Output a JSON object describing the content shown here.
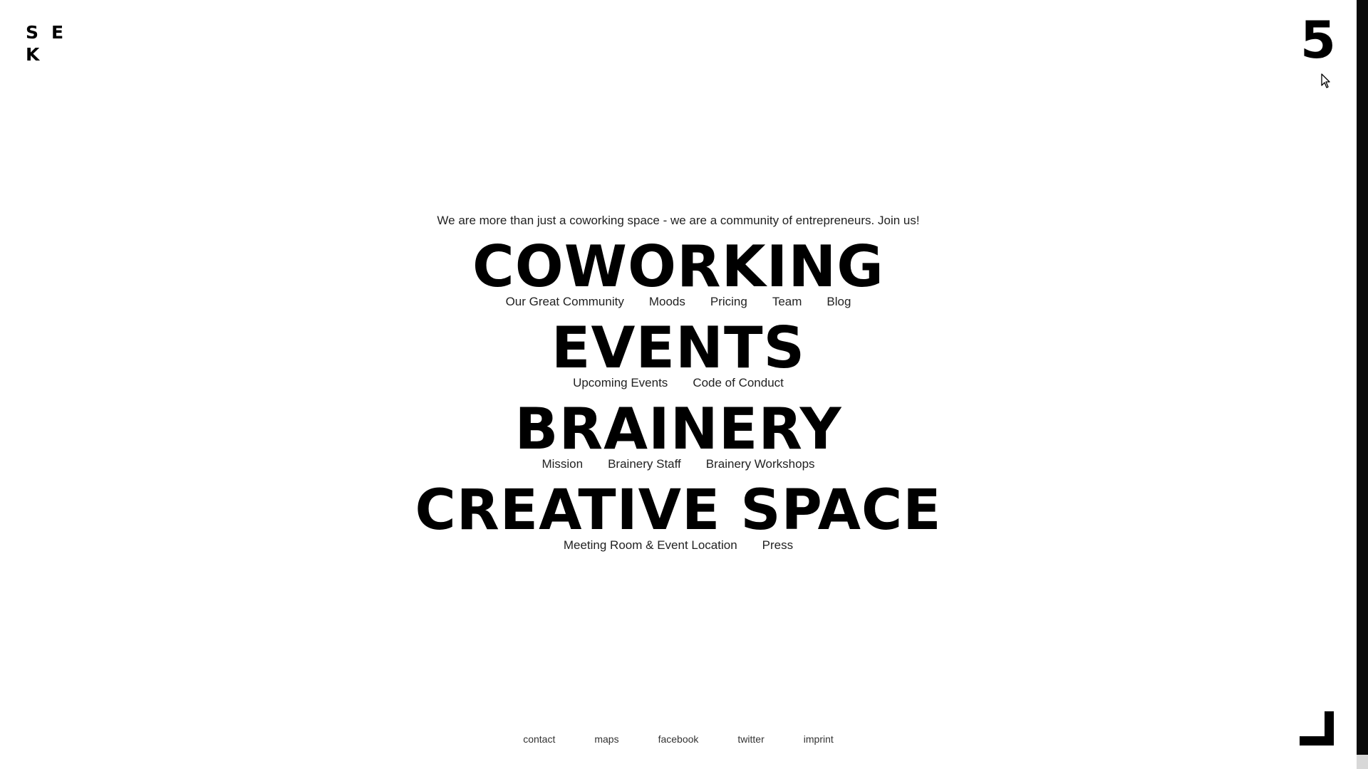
{
  "logo": {
    "letters": [
      "S",
      "E",
      "K"
    ]
  },
  "header": {
    "number": "5"
  },
  "intro": {
    "text": "We are more than just a coworking space - we are a community of entrepreneurs.  Join us!"
  },
  "sections": [
    {
      "title": "COWORKING",
      "links": [
        "Our Great Community",
        "Moods",
        "Pricing",
        "Team",
        "Blog"
      ]
    },
    {
      "title": "EVENTS",
      "links": [
        "Upcoming Events",
        "Code of Conduct"
      ]
    },
    {
      "title": "BRAINERY",
      "links": [
        "Mission",
        "Brainery Staff",
        "Brainery Workshops"
      ]
    },
    {
      "title": "CREATIVE SPACE",
      "links": [
        "Meeting Room & Event Location",
        "Press"
      ]
    }
  ],
  "footer": {
    "links": [
      "contact",
      "maps",
      "facebook",
      "twitter",
      "imprint"
    ]
  },
  "icons": {
    "cursor": "mouse-pointer-icon",
    "corner": "corner-bracket-icon"
  },
  "colors": {
    "text": "#000000",
    "background": "#ffffff"
  }
}
